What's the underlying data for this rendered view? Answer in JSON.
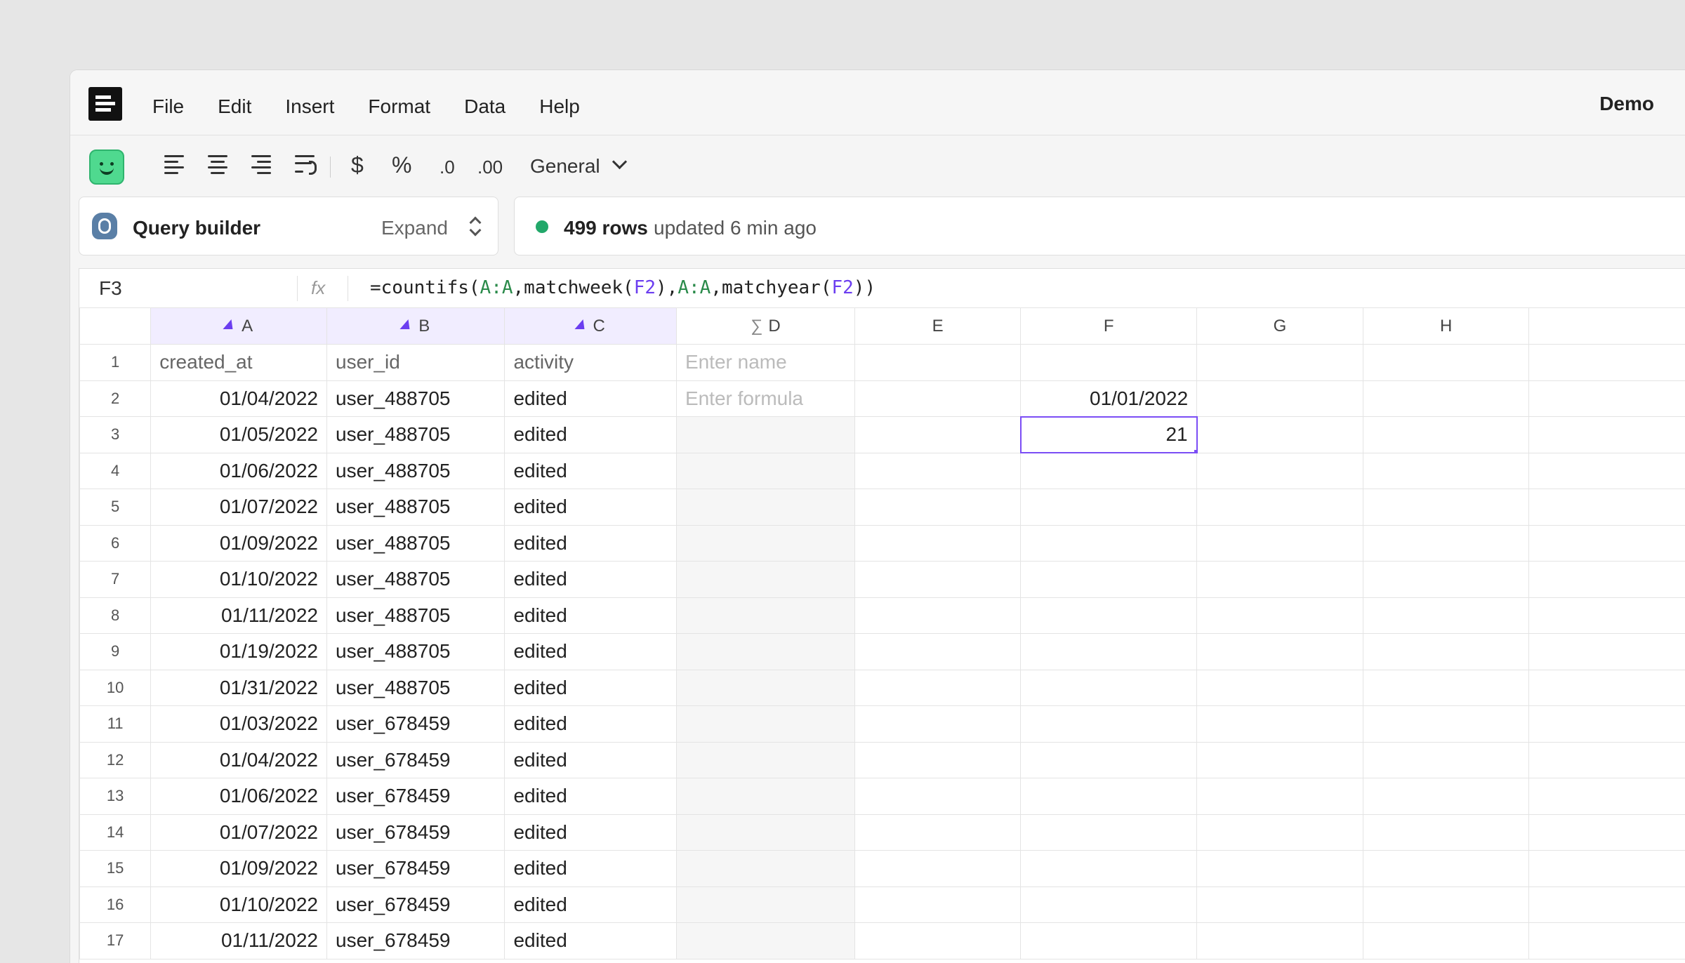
{
  "menubar": {
    "items": [
      "File",
      "Edit",
      "Insert",
      "Format",
      "Data",
      "Help"
    ],
    "doc_title": "Demo"
  },
  "toolbar": {
    "currency": "$",
    "percent": "%",
    "decrease_decimals": ".0",
    "increase_decimals": ".00",
    "number_format": "General"
  },
  "query_builder": {
    "label": "Query builder",
    "expand": "Expand"
  },
  "status": {
    "rows": "499 rows",
    "updated": "updated 6 min ago",
    "dot_color": "#22a86a"
  },
  "formula_bar": {
    "cell_ref": "F3",
    "fx": "fx",
    "formula_parts": [
      "=countifs(",
      "A:A",
      ",matchweek(",
      "F2",
      "),",
      "A:A",
      ",matchyear(",
      "F2",
      "))"
    ]
  },
  "columns": [
    {
      "letter": "A",
      "kind": "live"
    },
    {
      "letter": "B",
      "kind": "live"
    },
    {
      "letter": "C",
      "kind": "live"
    },
    {
      "letter": "D",
      "kind": "formula"
    },
    {
      "letter": "E",
      "kind": "plain"
    },
    {
      "letter": "F",
      "kind": "plain"
    },
    {
      "letter": "G",
      "kind": "plain"
    },
    {
      "letter": "H",
      "kind": "plain"
    },
    {
      "letter": "",
      "kind": "plain"
    }
  ],
  "header_row": {
    "a": "created_at",
    "b": "user_id",
    "c": "activity",
    "d_placeholder": "Enter name"
  },
  "d2_placeholder": "Enter formula",
  "f2": "01/01/2022",
  "f3": "21",
  "rows": [
    {
      "n": "2",
      "a": "01/04/2022",
      "b": "user_488705",
      "c": "edited"
    },
    {
      "n": "3",
      "a": "01/05/2022",
      "b": "user_488705",
      "c": "edited"
    },
    {
      "n": "4",
      "a": "01/06/2022",
      "b": "user_488705",
      "c": "edited"
    },
    {
      "n": "5",
      "a": "01/07/2022",
      "b": "user_488705",
      "c": "edited"
    },
    {
      "n": "6",
      "a": "01/09/2022",
      "b": "user_488705",
      "c": "edited"
    },
    {
      "n": "7",
      "a": "01/10/2022",
      "b": "user_488705",
      "c": "edited"
    },
    {
      "n": "8",
      "a": "01/11/2022",
      "b": "user_488705",
      "c": "edited"
    },
    {
      "n": "9",
      "a": "01/19/2022",
      "b": "user_488705",
      "c": "edited"
    },
    {
      "n": "10",
      "a": "01/31/2022",
      "b": "user_488705",
      "c": "edited"
    },
    {
      "n": "11",
      "a": "01/03/2022",
      "b": "user_678459",
      "c": "edited"
    },
    {
      "n": "12",
      "a": "01/04/2022",
      "b": "user_678459",
      "c": "edited"
    },
    {
      "n": "13",
      "a": "01/06/2022",
      "b": "user_678459",
      "c": "edited"
    },
    {
      "n": "14",
      "a": "01/07/2022",
      "b": "user_678459",
      "c": "edited"
    },
    {
      "n": "15",
      "a": "01/09/2022",
      "b": "user_678459",
      "c": "edited"
    },
    {
      "n": "16",
      "a": "01/10/2022",
      "b": "user_678459",
      "c": "edited"
    },
    {
      "n": "17",
      "a": "01/11/2022",
      "b": "user_678459",
      "c": "edited"
    }
  ],
  "accent_color": "#6b3df0"
}
